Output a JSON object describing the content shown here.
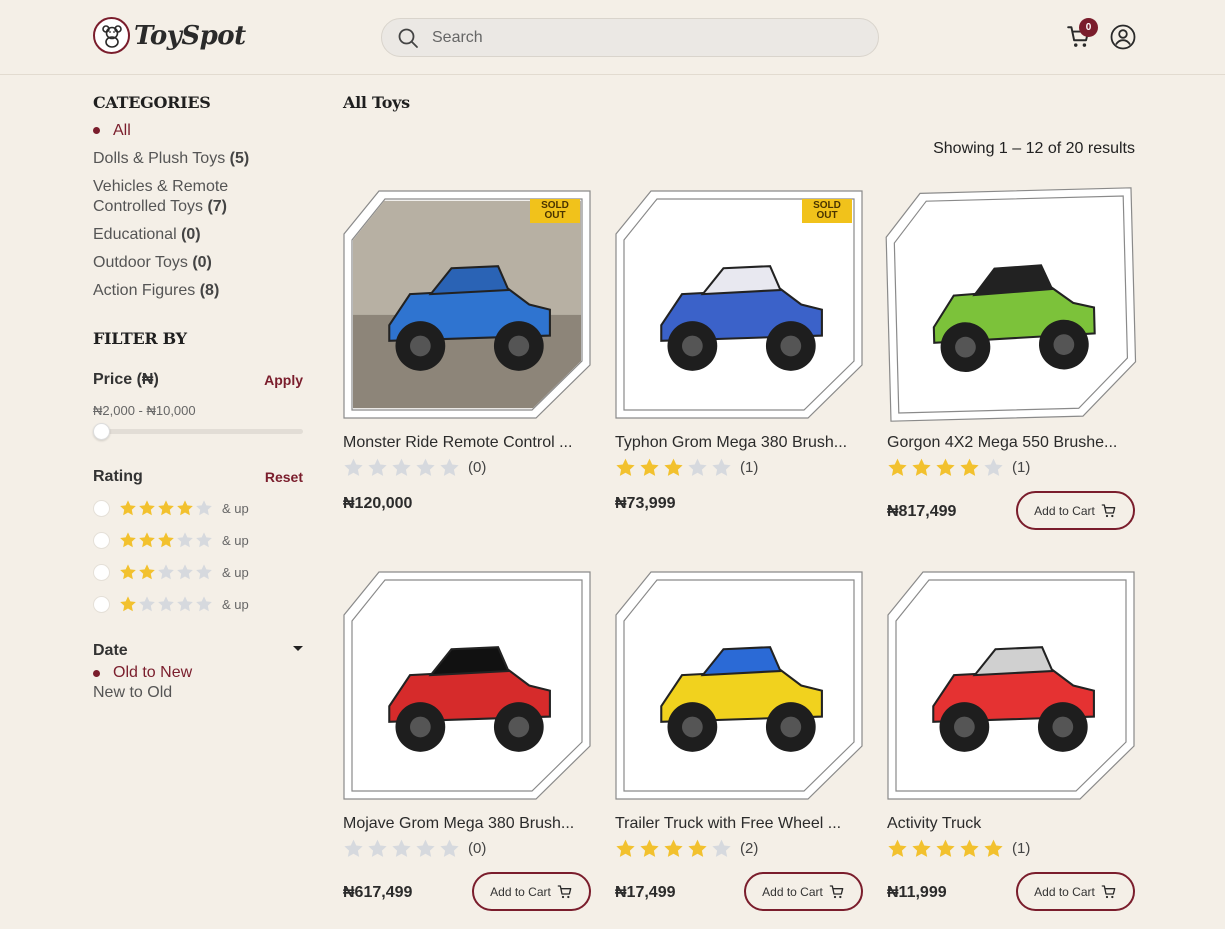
{
  "header": {
    "brand": "ToySpot",
    "search_placeholder": "Search",
    "cart_count": "0"
  },
  "sidebar": {
    "categories_title": "CATEGORIES",
    "categories": [
      {
        "label": "All",
        "count": ""
      },
      {
        "label": "Dolls & Plush Toys",
        "count": "(5)"
      },
      {
        "label": "Vehicles & Remote Controlled Toys",
        "count": "(7)"
      },
      {
        "label": "Educational",
        "count": "(0)"
      },
      {
        "label": "Outdoor Toys",
        "count": "(0)"
      },
      {
        "label": "Action Figures",
        "count": "(8)"
      }
    ],
    "filter_title": "FILTER BY",
    "price_label": "Price (₦)",
    "apply_label": "Apply",
    "price_range": "₦2,000 - ₦10,000",
    "price_slider_value": 0,
    "rating_label": "Rating",
    "reset_label": "Reset",
    "rating_options": [
      {
        "stars": 4,
        "suffix": "& up"
      },
      {
        "stars": 3,
        "suffix": "& up"
      },
      {
        "stars": 2,
        "suffix": "& up"
      },
      {
        "stars": 1,
        "suffix": "& up"
      }
    ],
    "date_label": "Date",
    "date_options": [
      "Old to New",
      "New to Old"
    ]
  },
  "main": {
    "title": "All Toys",
    "results_text": "Showing 1 – 12 of 20 results",
    "add_to_cart_label": "Add to Cart",
    "sold_out_label": "SOLD OUT",
    "products": [
      {
        "name": "Monster Ride Remote Control ...",
        "rating": 0,
        "reviews": "(0)",
        "price": "₦120,000",
        "sold_out": true
      },
      {
        "name": "Typhon Grom Mega 380 Brush...",
        "rating": 3,
        "reviews": "(1)",
        "price": "₦73,999",
        "sold_out": true
      },
      {
        "name": "Gorgon 4X2 Mega 550 Brushe...",
        "rating": 4,
        "reviews": "(1)",
        "price": "₦817,499",
        "sold_out": false
      },
      {
        "name": "Mojave Grom Mega 380 Brush...",
        "rating": 0,
        "reviews": "(0)",
        "price": "₦617,499",
        "sold_out": false
      },
      {
        "name": "Trailer Truck with Free Wheel ...",
        "rating": 4,
        "reviews": "(2)",
        "price": "₦17,499",
        "sold_out": false
      },
      {
        "name": "Activity Truck",
        "rating": 5,
        "reviews": "(1)",
        "price": "₦11,999",
        "sold_out": false
      }
    ]
  },
  "colors": {
    "accent": "#7a1d2c",
    "star_filled": "#f2c12e",
    "star_empty": "#d6d9de",
    "background": "#f4efe7",
    "sold_badge": "#f1c21b"
  }
}
